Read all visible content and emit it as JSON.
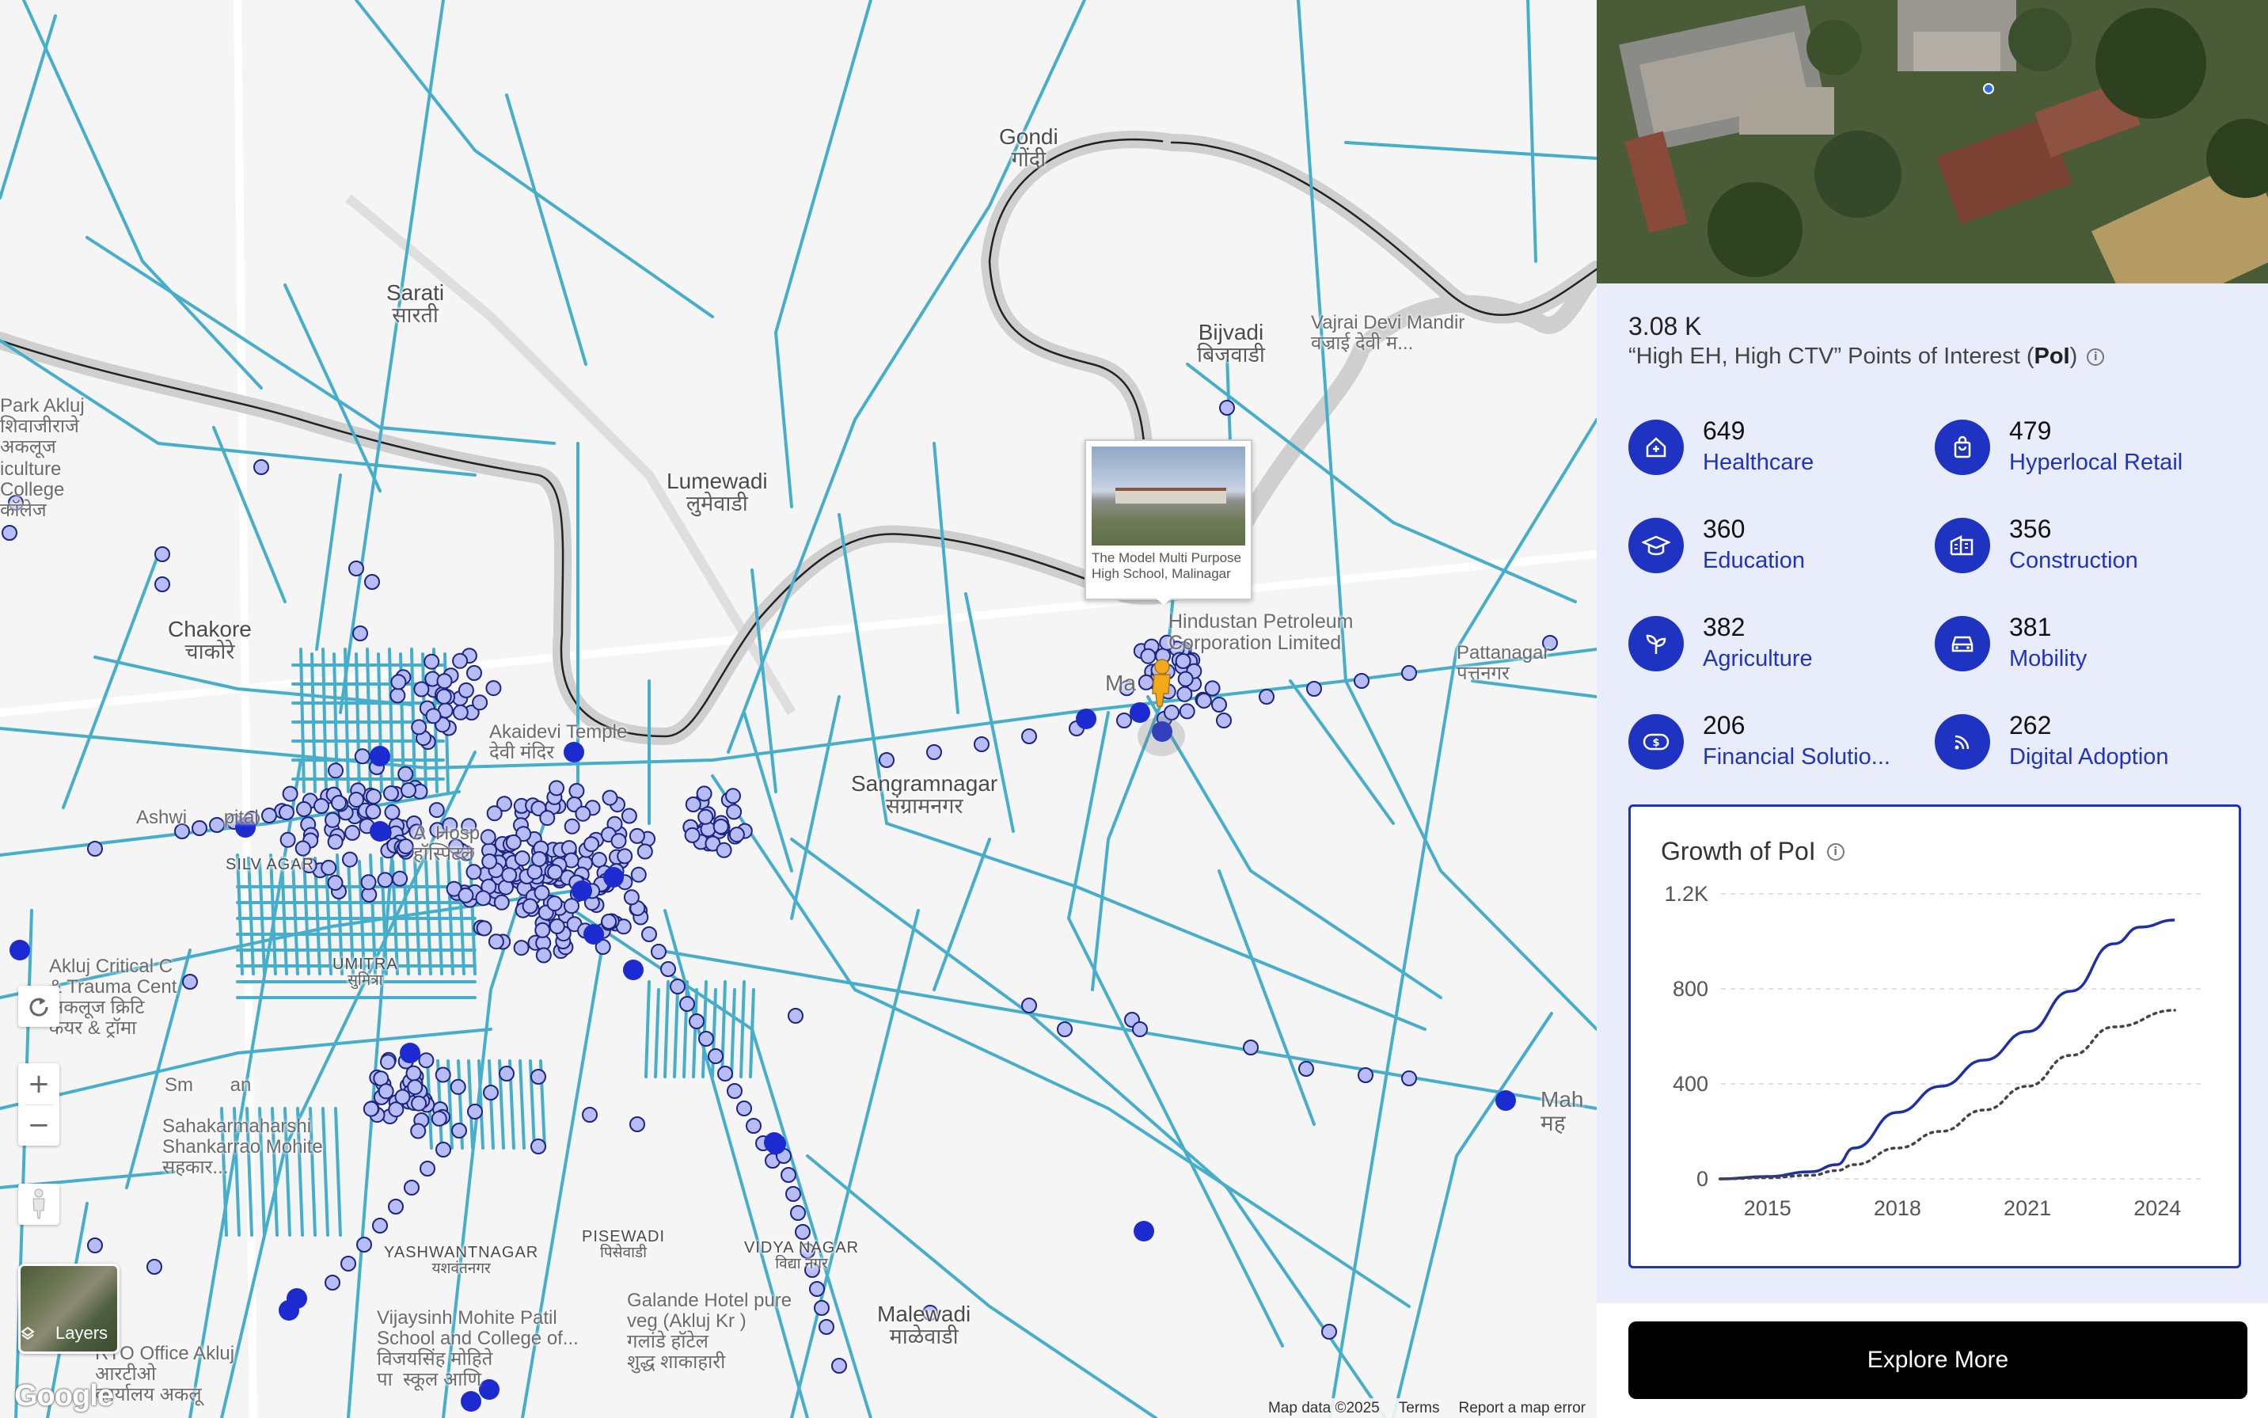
{
  "map": {
    "places": [
      {
        "id": "gondi",
        "en": "Gondi",
        "hi": "गोंदी"
      },
      {
        "id": "sarati",
        "en": "Sarati",
        "hi": "सारती"
      },
      {
        "id": "bijvadi",
        "en": "Bijvadi",
        "hi": "बिजवाडी"
      },
      {
        "id": "lumewadi",
        "en": "Lumewadi",
        "hi": "लुमेवाडी"
      },
      {
        "id": "chakore",
        "en": "Chakore",
        "hi": "चाकोरे"
      },
      {
        "id": "sangramnagar",
        "en": "Sangramnagar",
        "hi": "संग्रामनगर"
      },
      {
        "id": "malewadi",
        "en": "Malewadi",
        "hi": "माळेवाडी"
      }
    ],
    "small_places": [
      {
        "id": "yashwantnagar",
        "en": "YASHWANTNAGAR",
        "hi": "यशवंतनगर"
      },
      {
        "id": "pisewadi",
        "en": "PISEWADI",
        "hi": "पिसेवाडी"
      },
      {
        "id": "vidyanagar",
        "en": "VIDYA NAGAR",
        "hi": "विद्या नगर"
      },
      {
        "id": "sumitra",
        "en": "UMITRA",
        "hi": "सुमित्रा"
      },
      {
        "id": "silvar",
        "en": "SILV  AGAR",
        "hi": ""
      }
    ],
    "poi_labels": {
      "park": "Park Akluj\nशिवाजीराजे\nअकलूज",
      "college": "iculture\nCollege\nकॉलेज",
      "vajrai": "Vajrai Devi Mandir\nवज्राई देवी म...",
      "hindustan": "Hindustan Petroleum\nCorporation Limited",
      "akai": "Akaidevi Temple\nदेवी मंदिर",
      "ashwini": "Ashwi       pital",
      "hosp": "A  Hosp\nहॉस्पिटल",
      "akluj_critical": "Akluj Critical C\n& Trauma Cent\nअकलूज क्रिटि\nकेयर & ट्रॉमा",
      "sahakar": "Sahakarmaharshi\nShankarrao Mohite\nसहकार...",
      "vijaysinh": "Vijaysinh Mohite Patil\nSchool and College of...\nविजयसिंह मोहिते\nपा  स्कूल आणि",
      "rto": "RTO Office Akluj\nआरटीओ\nकार्यालय अकलू",
      "galande": "Galande Hotel pure\nveg (Akluj Kr )\nगलांडे हॉटेल\nशुद्ध शाकाहारी",
      "maha": "Mah\nमह",
      "pattanagar": "Pattanagar\nपत्तनगर",
      "smr": "Sm       an",
      "ma": "Ma"
    },
    "info_card": {
      "name": "The Model Multi Purpose High School, Malinagar"
    },
    "layers_label": "Layers",
    "google_logo": "Google",
    "attribution": {
      "data": "Map data ©2025",
      "terms": "Terms",
      "report": "Report a map error"
    },
    "icons": {
      "rotate": "rotate-icon",
      "zoom_in": "+",
      "zoom_out": "−",
      "pegman": "pegman-icon"
    }
  },
  "panel": {
    "total_value": "3.08 K",
    "total_label_pre": "“High EH, High CTV” Points of Interest (",
    "total_label_abbr": "PoI",
    "total_label_post": ")",
    "categories": [
      {
        "value": "649",
        "label": "Healthcare",
        "icon": "health-icon"
      },
      {
        "value": "479",
        "label": "Hyperlocal Retail",
        "icon": "shopping-bag-icon"
      },
      {
        "value": "360",
        "label": "Education",
        "icon": "graduation-cap-icon"
      },
      {
        "value": "356",
        "label": "Construction",
        "icon": "building-icon"
      },
      {
        "value": "382",
        "label": "Agriculture",
        "icon": "sprout-icon"
      },
      {
        "value": "381",
        "label": "Mobility",
        "icon": "car-icon"
      },
      {
        "value": "206",
        "label": "Financial Solutio...",
        "icon": "money-icon"
      },
      {
        "value": "262",
        "label": "Digital Adoption",
        "icon": "rss-icon"
      }
    ],
    "explore_label": "Explore More",
    "accent": "#1f33c2"
  },
  "chart_data": {
    "type": "line",
    "title": "Growth of PoI",
    "xlabel": "",
    "ylabel": "",
    "x_ticks": [
      "2015",
      "2018",
      "2021",
      "2024"
    ],
    "y_ticks": [
      "0",
      "400",
      "800",
      "1.2K"
    ],
    "ylim": [
      0,
      1200
    ],
    "xlim": [
      2014,
      2025
    ],
    "grid": true,
    "series": [
      {
        "style": "solid",
        "color": "#1f2fa8",
        "x": [
          2013.9,
          2015,
          2016,
          2016.6,
          2017,
          2018,
          2019,
          2020,
          2021,
          2022,
          2023,
          2023.6,
          2024.4
        ],
        "y": [
          0,
          10,
          30,
          60,
          130,
          280,
          390,
          500,
          620,
          790,
          990,
          1060,
          1090
        ]
      },
      {
        "style": "dotted",
        "color": "#444444",
        "x": [
          2013.9,
          2015,
          2016,
          2016.6,
          2017,
          2018,
          2019,
          2020,
          2021,
          2022,
          2023,
          2024.4
        ],
        "y": [
          0,
          5,
          15,
          35,
          60,
          130,
          200,
          290,
          390,
          520,
          640,
          710
        ]
      }
    ]
  }
}
